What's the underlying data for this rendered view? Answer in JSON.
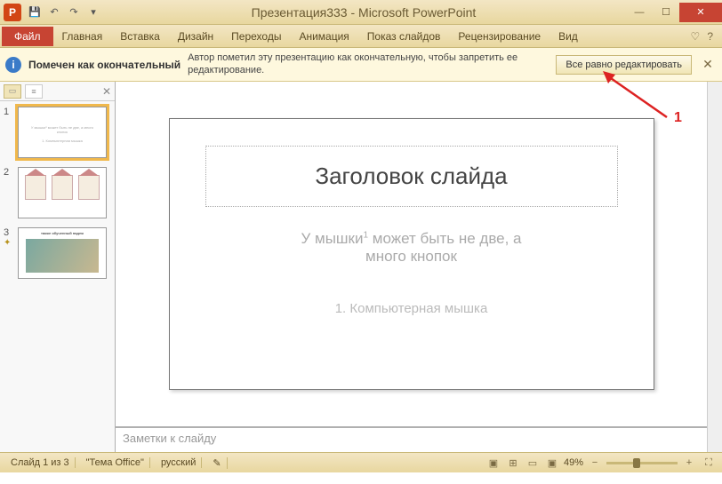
{
  "title": "Презентация333  -  Microsoft PowerPoint",
  "tabs": {
    "file": "Файл",
    "home": "Главная",
    "insert": "Вставка",
    "design": "Дизайн",
    "transitions": "Переходы",
    "animations": "Анимация",
    "slideshow": "Показ слайдов",
    "review": "Рецензирование",
    "view": "Вид"
  },
  "infobar": {
    "title": "Помечен как окончательный",
    "message": "Автор пометил эту презентацию как окончательную, чтобы запретить ее редактирование.",
    "button": "Все равно редактировать"
  },
  "thumbs": [
    {
      "num": "1",
      "preview_line1": "У мышки¹ может быть не две, а много кнопок",
      "preview_line2": "1. Компьютерная мышка"
    },
    {
      "num": "2"
    },
    {
      "num": "3",
      "title": "также обученный падеж"
    }
  ],
  "slide": {
    "title": "Заголовок слайда",
    "body": "У мышки¹ может быть не две, а много кнопок",
    "foot": "1. Компьютерная мышка"
  },
  "notes_placeholder": "Заметки к слайду",
  "status": {
    "slide_pos": "Слайд 1 из 3",
    "theme": "\"Тема Office\"",
    "lang": "русский",
    "zoom": "49%"
  },
  "annotation": {
    "label": "1"
  },
  "colors": {
    "accent_orange": "#c74433",
    "gold_light": "#f3e6c4",
    "gold_dark": "#e8d79f"
  }
}
